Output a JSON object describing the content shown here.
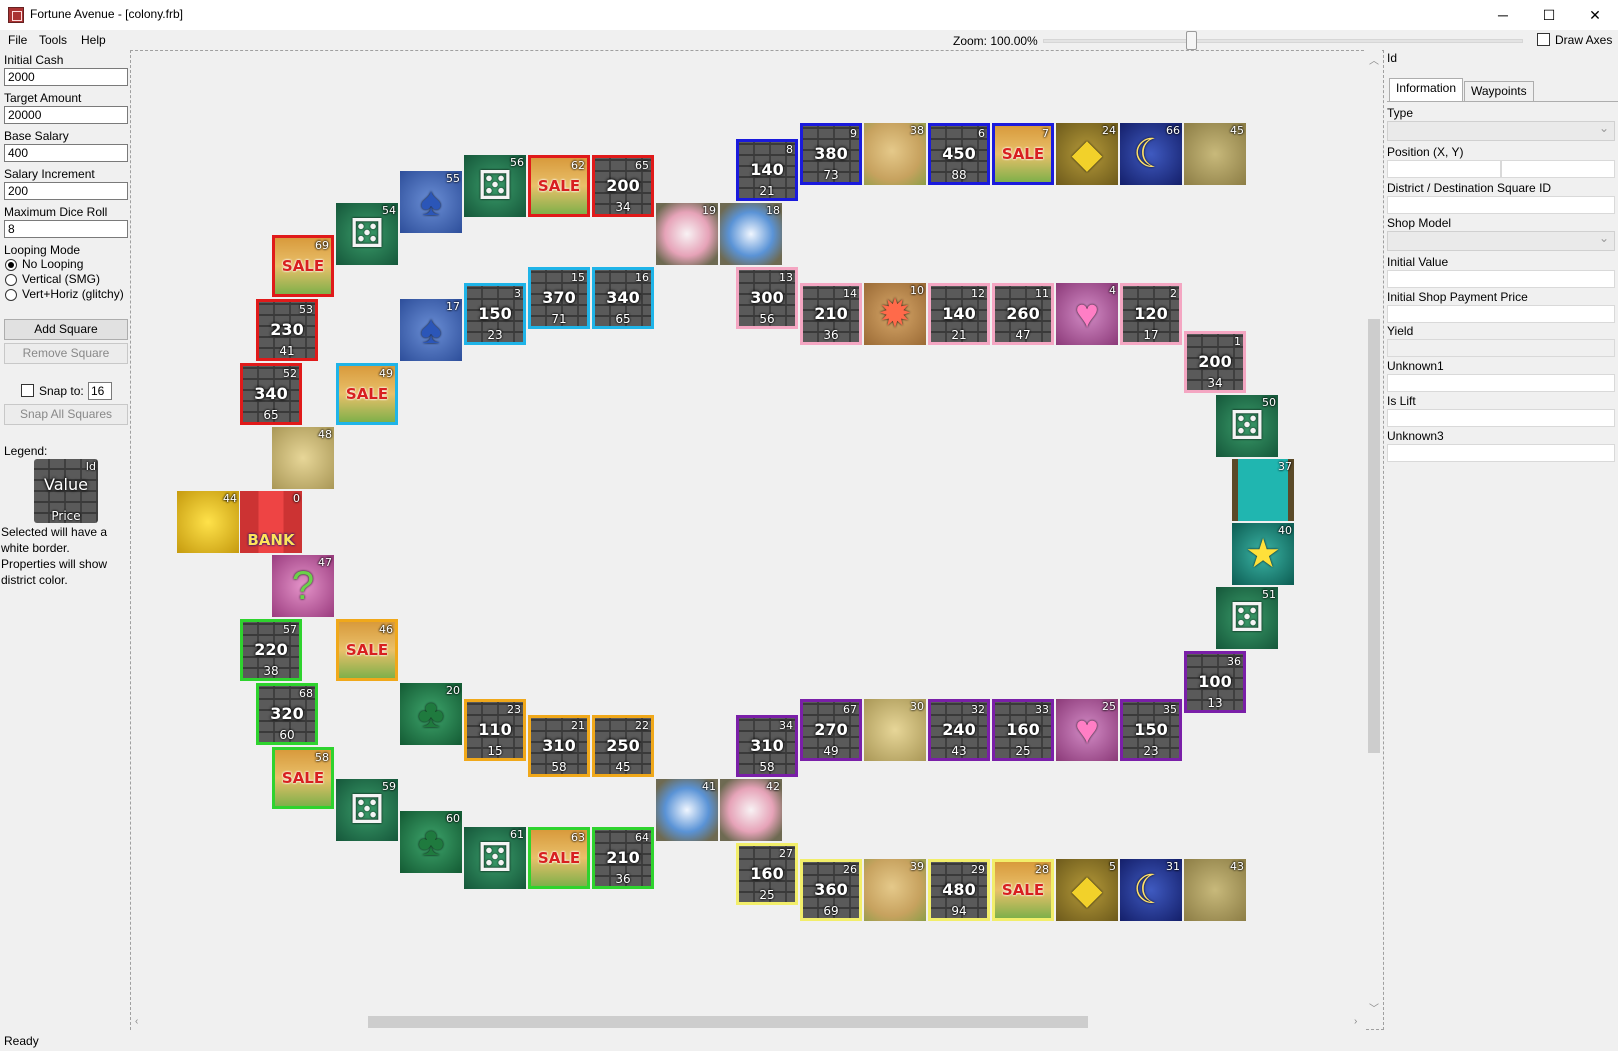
{
  "window": {
    "title": "Fortune Avenue - [colony.frb]",
    "minimize": "─",
    "maximize": "☐",
    "close": "✕"
  },
  "menu": [
    "File",
    "Tools",
    "Help"
  ],
  "toolbar": {
    "zoom_label": "Zoom: 100.00%",
    "zoom_fraction": 0.3,
    "draw_axes_label": "Draw Axes"
  },
  "left": {
    "initial_cash_label": "Initial Cash",
    "initial_cash": "2000",
    "target_amount_label": "Target Amount",
    "target_amount": "20000",
    "base_salary_label": "Base Salary",
    "base_salary": "400",
    "salary_increment_label": "Salary Increment",
    "salary_increment": "200",
    "max_dice_label": "Maximum Dice Roll",
    "max_dice": "8",
    "looping_label": "Looping Mode",
    "looping_options": [
      "No Looping",
      "Vertical (SMG)",
      "Vert+Horiz (glitchy)"
    ],
    "looping_selected": 0,
    "add_square": "Add Square",
    "remove_square": "Remove Square",
    "snap_label": "Snap to:",
    "snap_value": "16",
    "snap_all": "Snap All Squares",
    "legend_label": "Legend:",
    "legend_value": "Value",
    "legend_price": "Price",
    "legend_id": "Id",
    "legend_note": "Selected will have a white border. Properties will show district color."
  },
  "right": {
    "id_label": "Id",
    "tabs": [
      "Information",
      "Waypoints"
    ],
    "fields": [
      "Type",
      "Position (X, Y)",
      "District / Destination Square ID",
      "Shop Model",
      "Initial Value",
      "Initial Shop Payment Price",
      "Yield",
      "Unknown1",
      "Is Lift",
      "Unknown3"
    ]
  },
  "status": "Ready",
  "district_colors": {
    "red": "#e01a1a",
    "blue": "#1a1adc",
    "cyan": "#1fb4e8",
    "pink": "#f4a6c2",
    "purple": "#7a1fa8",
    "yellow": "#f2ee6a",
    "orange": "#f0a81a",
    "green": "#2ed32e",
    "none": ""
  },
  "squares": [
    {
      "id": "44",
      "type": "cross",
      "district": "none"
    },
    {
      "id": "0",
      "type": "bank",
      "district": "none",
      "label": "BANK"
    },
    {
      "id": "47",
      "type": "question",
      "district": "none",
      "icon": "?"
    },
    {
      "id": "48",
      "type": "arcade",
      "district": "none"
    },
    {
      "id": "52",
      "type": "property",
      "district": "red",
      "value": "340",
      "price": "65"
    },
    {
      "id": "53",
      "type": "property",
      "district": "red",
      "value": "230",
      "price": "41"
    },
    {
      "id": "69",
      "type": "sale",
      "district": "red",
      "label": "SALE"
    },
    {
      "id": "54",
      "type": "dice",
      "district": "none",
      "icon": "⚄"
    },
    {
      "id": "55",
      "type": "spade",
      "district": "none",
      "icon": "♠"
    },
    {
      "id": "56",
      "type": "dice",
      "district": "none",
      "icon": "⚄"
    },
    {
      "id": "62",
      "type": "sale",
      "district": "red",
      "label": "SALE"
    },
    {
      "id": "65",
      "type": "property",
      "district": "red",
      "value": "200",
      "price": "34"
    },
    {
      "id": "19",
      "type": "swirl-pink",
      "district": "none"
    },
    {
      "id": "18",
      "type": "swirl-blue",
      "district": "none"
    },
    {
      "id": "8",
      "type": "property",
      "district": "blue",
      "value": "140",
      "price": "21"
    },
    {
      "id": "9",
      "type": "property",
      "district": "blue",
      "value": "380",
      "price": "73"
    },
    {
      "id": "38",
      "type": "vacant",
      "district": "none"
    },
    {
      "id": "6",
      "type": "property",
      "district": "blue",
      "value": "450",
      "price": "88"
    },
    {
      "id": "7",
      "type": "sale",
      "district": "blue",
      "label": "SALE"
    },
    {
      "id": "24",
      "type": "diamond",
      "district": "none",
      "icon": "◆"
    },
    {
      "id": "66",
      "type": "moon",
      "district": "none",
      "icon": "☾"
    },
    {
      "id": "45",
      "type": "rocks",
      "district": "none"
    },
    {
      "id": "17",
      "type": "spade",
      "district": "none",
      "icon": "♠"
    },
    {
      "id": "3",
      "type": "property",
      "district": "cyan",
      "value": "150",
      "price": "23"
    },
    {
      "id": "15",
      "type": "property",
      "district": "cyan",
      "value": "370",
      "price": "71"
    },
    {
      "id": "16",
      "type": "property",
      "district": "cyan",
      "value": "340",
      "price": "65"
    },
    {
      "id": "49",
      "type": "sale",
      "district": "cyan",
      "label": "SALE"
    },
    {
      "id": "13",
      "type": "property",
      "district": "pink",
      "value": "300",
      "price": "56"
    },
    {
      "id": "14",
      "type": "property",
      "district": "pink",
      "value": "210",
      "price": "36"
    },
    {
      "id": "10",
      "type": "sun",
      "district": "none",
      "icon": "✹"
    },
    {
      "id": "12",
      "type": "property",
      "district": "pink",
      "value": "140",
      "price": "21"
    },
    {
      "id": "11",
      "type": "property",
      "district": "pink",
      "value": "260",
      "price": "47"
    },
    {
      "id": "4",
      "type": "heart",
      "district": "none",
      "icon": "♥"
    },
    {
      "id": "2",
      "type": "property",
      "district": "pink",
      "value": "120",
      "price": "17"
    },
    {
      "id": "1",
      "type": "property",
      "district": "pink",
      "value": "200",
      "price": "34"
    },
    {
      "id": "50",
      "type": "dice",
      "district": "none",
      "icon": "⚄"
    },
    {
      "id": "37",
      "type": "lift",
      "district": "none"
    },
    {
      "id": "40",
      "type": "star",
      "district": "none",
      "icon": "★"
    },
    {
      "id": "51",
      "type": "dice",
      "district": "none",
      "icon": "⚄"
    },
    {
      "id": "36",
      "type": "property",
      "district": "purple",
      "value": "100",
      "price": "13"
    },
    {
      "id": "35",
      "type": "property",
      "district": "purple",
      "value": "150",
      "price": "23"
    },
    {
      "id": "25",
      "type": "heart",
      "district": "none",
      "icon": "♥"
    },
    {
      "id": "33",
      "type": "property",
      "district": "purple",
      "value": "160",
      "price": "25"
    },
    {
      "id": "32",
      "type": "property",
      "district": "purple",
      "value": "240",
      "price": "43"
    },
    {
      "id": "30",
      "type": "arcade",
      "district": "none"
    },
    {
      "id": "67",
      "type": "property",
      "district": "purple",
      "value": "270",
      "price": "49"
    },
    {
      "id": "34",
      "type": "property",
      "district": "purple",
      "value": "310",
      "price": "58"
    },
    {
      "id": "41",
      "type": "swirl-blue",
      "district": "none"
    },
    {
      "id": "42",
      "type": "swirl-pink",
      "district": "none"
    },
    {
      "id": "27",
      "type": "property",
      "district": "yellow",
      "value": "160",
      "price": "25"
    },
    {
      "id": "26",
      "type": "property",
      "district": "yellow",
      "value": "360",
      "price": "69"
    },
    {
      "id": "39",
      "type": "vacant",
      "district": "none"
    },
    {
      "id": "29",
      "type": "property",
      "district": "yellow",
      "value": "480",
      "price": "94"
    },
    {
      "id": "28",
      "type": "sale",
      "district": "yellow",
      "label": "SALE"
    },
    {
      "id": "5",
      "type": "diamond",
      "district": "none",
      "icon": "◆"
    },
    {
      "id": "31",
      "type": "moon",
      "district": "none",
      "icon": "☾"
    },
    {
      "id": "43",
      "type": "rocks",
      "district": "none"
    },
    {
      "id": "57",
      "type": "property",
      "district": "green",
      "value": "220",
      "price": "38"
    },
    {
      "id": "68",
      "type": "property",
      "district": "green",
      "value": "320",
      "price": "60"
    },
    {
      "id": "58",
      "type": "sale",
      "district": "green",
      "label": "SALE"
    },
    {
      "id": "59",
      "type": "dice",
      "district": "none",
      "icon": "⚄"
    },
    {
      "id": "60",
      "type": "club",
      "district": "none",
      "icon": "♣"
    },
    {
      "id": "61",
      "type": "dice",
      "district": "none",
      "icon": "⚄"
    },
    {
      "id": "63",
      "type": "sale",
      "district": "green",
      "label": "SALE"
    },
    {
      "id": "64",
      "type": "property",
      "district": "green",
      "value": "210",
      "price": "36"
    },
    {
      "id": "46",
      "type": "sale",
      "district": "orange",
      "label": "SALE"
    },
    {
      "id": "20",
      "type": "club",
      "district": "none",
      "icon": "♣"
    },
    {
      "id": "23",
      "type": "property",
      "district": "orange",
      "value": "110",
      "price": "15"
    },
    {
      "id": "21",
      "type": "property",
      "district": "orange",
      "value": "310",
      "price": "58"
    },
    {
      "id": "22",
      "type": "property",
      "district": "orange",
      "value": "250",
      "price": "45"
    }
  ]
}
